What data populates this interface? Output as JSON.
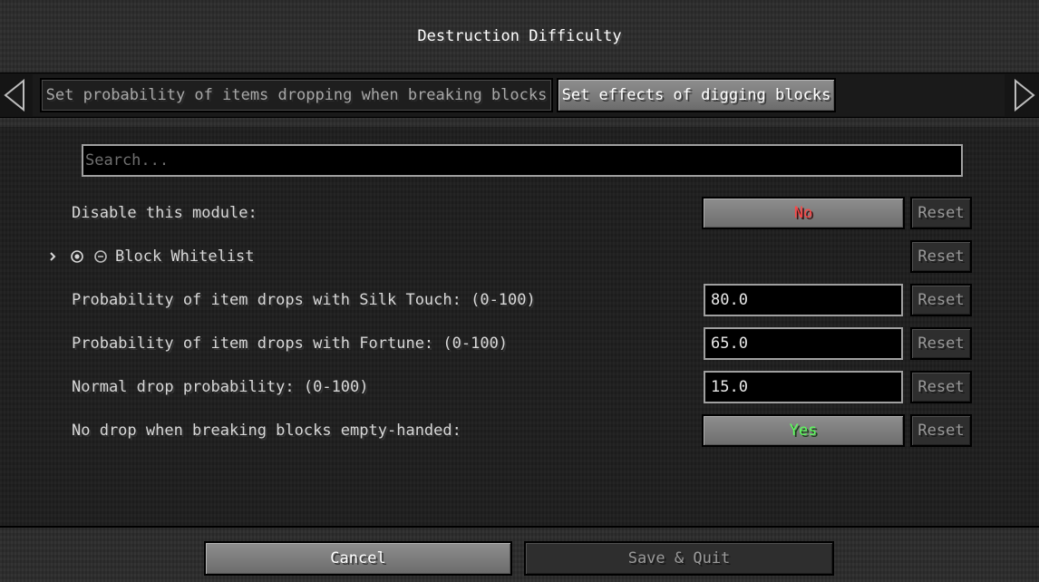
{
  "screen": {
    "title": "Destruction Difficulty"
  },
  "tabs": [
    {
      "label": "Set probability of items dropping when breaking blocks",
      "selected": false
    },
    {
      "label": "Set effects of digging blocks",
      "selected": true
    }
  ],
  "nav": {
    "left_icon": "triangle-left-icon",
    "right_icon": "triangle-right-icon"
  },
  "search": {
    "placeholder": "Search..."
  },
  "options": {
    "disable_module": {
      "label": "Disable this module:",
      "value": "No"
    },
    "block_whitelist": {
      "label": "Block Whitelist",
      "expand_icon": "chevron-right-icon",
      "add_icon": "plus-circle-icon",
      "remove_icon": "minus-circle-icon"
    },
    "silk_touch": {
      "label": "Probability of item drops with Silk Touch: (0-100)",
      "value": "80.0"
    },
    "fortune": {
      "label": "Probability of item drops with Fortune: (0-100)",
      "value": "65.0"
    },
    "normal_drop": {
      "label": "Normal drop probability: (0-100)",
      "value": "15.0"
    },
    "empty_hand": {
      "label": "No drop when breaking blocks empty-handed:",
      "value": "Yes"
    }
  },
  "reset_label": "Reset",
  "footer": {
    "cancel_label": "Cancel",
    "save_quit_label": "Save & Quit"
  },
  "colors": {
    "toggle_no": "#ff4747",
    "toggle_yes": "#5cff5c"
  }
}
